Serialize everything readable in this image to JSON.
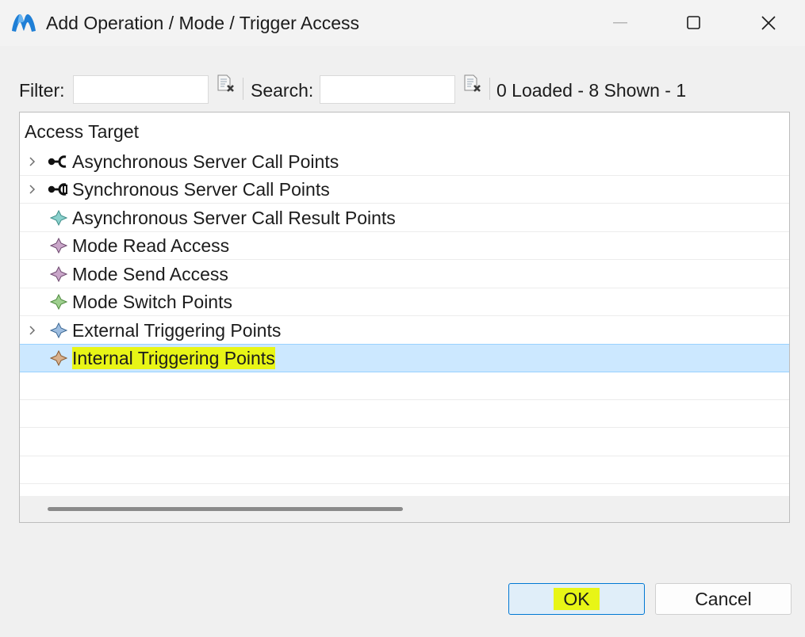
{
  "window": {
    "title": "Add Operation / Mode / Trigger Access",
    "app_icon": "blue-m-logo-icon"
  },
  "toolbar": {
    "filter_label": "Filter:",
    "filter_value": "",
    "search_label": "Search:",
    "search_value": "",
    "status": "0 Loaded - 8 Shown - 1"
  },
  "tree": {
    "column_header": "Access Target",
    "items": [
      {
        "label": "Asynchronous Server Call Points",
        "expandable": true,
        "icon": "async-call-icon"
      },
      {
        "label": "Synchronous Server Call Points",
        "expandable": true,
        "icon": "sync-call-icon"
      },
      {
        "label": "Asynchronous Server Call Result Points",
        "expandable": false,
        "icon": "diamond-teal-icon"
      },
      {
        "label": "Mode Read Access",
        "expandable": false,
        "icon": "diamond-purple-icon"
      },
      {
        "label": "Mode Send Access",
        "expandable": false,
        "icon": "diamond-purple-icon"
      },
      {
        "label": "Mode Switch Points",
        "expandable": false,
        "icon": "diamond-green-icon"
      },
      {
        "label": "External Triggering Points",
        "expandable": true,
        "icon": "diamond-blue-icon"
      },
      {
        "label": "Internal Triggering Points",
        "expandable": false,
        "icon": "diamond-brown-icon",
        "selected": true
      }
    ]
  },
  "buttons": {
    "ok": "OK",
    "cancel": "Cancel"
  },
  "colors": {
    "selection": "#cce8ff",
    "highlight": "#e8f516",
    "accent": "#0078d4"
  }
}
